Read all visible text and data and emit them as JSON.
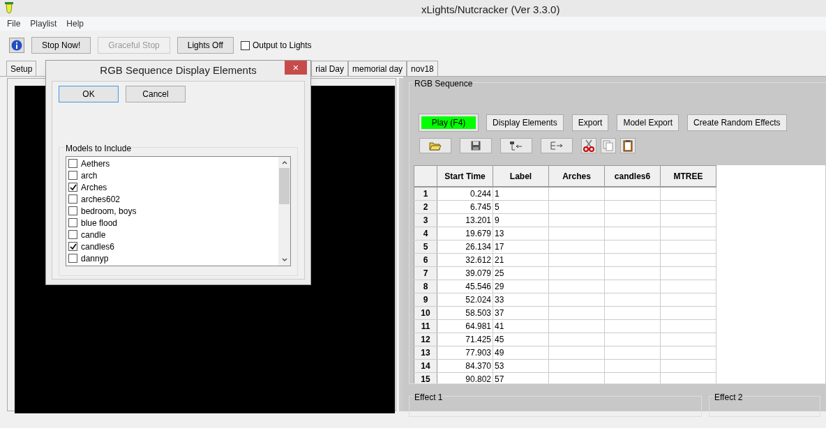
{
  "window": {
    "title": "xLights/Nutcracker  (Ver 3.3.0)"
  },
  "menu": [
    "File",
    "Playlist",
    "Help"
  ],
  "toolbar": {
    "buttons": [
      {
        "label": "Stop Now!",
        "disabled": false
      },
      {
        "label": "Graceful Stop",
        "disabled": true
      },
      {
        "label": "Lights Off",
        "disabled": false
      }
    ],
    "output_checkbox": {
      "label": "Output to Lights",
      "checked": false
    }
  },
  "tabs": [
    {
      "label": "Setup",
      "selected": false
    },
    {
      "label": "rial Day",
      "selected": false
    },
    {
      "label": "memorial day",
      "selected": false
    },
    {
      "label": "nov18",
      "selected": false
    }
  ],
  "rgb_sequence": {
    "title": "RGB Sequence",
    "buttons": [
      {
        "label": "Play (F4)",
        "highlighted": true
      },
      {
        "label": "Display Elements",
        "highlighted": false
      },
      {
        "label": "Export",
        "highlighted": false
      },
      {
        "label": "Model Export",
        "highlighted": false
      },
      {
        "label": "Create Random Effects",
        "highlighted": false
      }
    ],
    "grid": {
      "columns": [
        "Start Time",
        "Label",
        "Arches",
        "candles6",
        "MTREE"
      ],
      "rows": [
        {
          "number": "1",
          "start": "0.244",
          "label": "1"
        },
        {
          "number": "2",
          "start": "6.745",
          "label": "5"
        },
        {
          "number": "3",
          "start": "13.201",
          "label": "9"
        },
        {
          "number": "4",
          "start": "19.679",
          "label": "13"
        },
        {
          "number": "5",
          "start": "26.134",
          "label": "17"
        },
        {
          "number": "6",
          "start": "32.612",
          "label": "21"
        },
        {
          "number": "7",
          "start": "39.079",
          "label": "25"
        },
        {
          "number": "8",
          "start": "45.546",
          "label": "29"
        },
        {
          "number": "9",
          "start": "52.024",
          "label": "33"
        },
        {
          "number": "10",
          "start": "58.503",
          "label": "37"
        },
        {
          "number": "11",
          "start": "64.981",
          "label": "41"
        },
        {
          "number": "12",
          "start": "71.425",
          "label": "45"
        },
        {
          "number": "13",
          "start": "77.903",
          "label": "49"
        },
        {
          "number": "14",
          "start": "84.370",
          "label": "53"
        },
        {
          "number": "15",
          "start": "90.802",
          "label": "57"
        }
      ]
    }
  },
  "effects": [
    "Effect 1",
    "Effect 2"
  ],
  "dialog": {
    "title": "RGB Sequence Display Elements",
    "close": "×",
    "buttons": [
      {
        "label": "OK",
        "default": true
      },
      {
        "label": "Cancel",
        "default": false
      }
    ],
    "group": "Models to Include",
    "models": [
      {
        "name": "Aethers",
        "checked": false
      },
      {
        "name": "arch",
        "checked": false
      },
      {
        "name": "Arches",
        "checked": true
      },
      {
        "name": "arches602",
        "checked": false
      },
      {
        "name": "bedroom, boys",
        "checked": false
      },
      {
        "name": "blue flood",
        "checked": false
      },
      {
        "name": "candle",
        "checked": false
      },
      {
        "name": "candles6",
        "checked": true
      },
      {
        "name": "dannyp",
        "checked": false
      }
    ]
  }
}
